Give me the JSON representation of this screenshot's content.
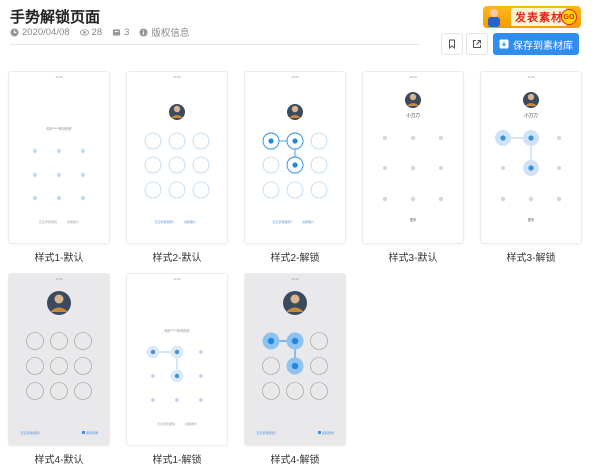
{
  "header": {
    "title": "手势解锁页面",
    "date": "2020/04/08",
    "views": "28",
    "files": "3",
    "license": "版权信息"
  },
  "promo": {
    "label": "发表素材",
    "go": "GO"
  },
  "actions": {
    "save_label": "保存到素材库"
  },
  "screens": {
    "time": "12:00",
    "hint_text": "你好*****你好你好",
    "username": "小刀刀",
    "more": "更多",
    "forgot_pattern": "忘记手势密码",
    "switch_account": "切换账户",
    "forgot_q": "忘记手势密码？",
    "use_password": "密码登录"
  },
  "cards": [
    {
      "caption": "样式1-默认"
    },
    {
      "caption": "样式2-默认"
    },
    {
      "caption": "样式2-解锁"
    },
    {
      "caption": "样式3-默认"
    },
    {
      "caption": "样式3-解锁"
    },
    {
      "caption": "样式4-默认"
    },
    {
      "caption": "样式1-解锁"
    },
    {
      "caption": "样式4-解锁"
    }
  ],
  "colors": {
    "accent": "#2f8df0",
    "dot": "#c8daf0",
    "dot_gray": "#d9d9d9",
    "ring_active": "#1e88e5"
  }
}
